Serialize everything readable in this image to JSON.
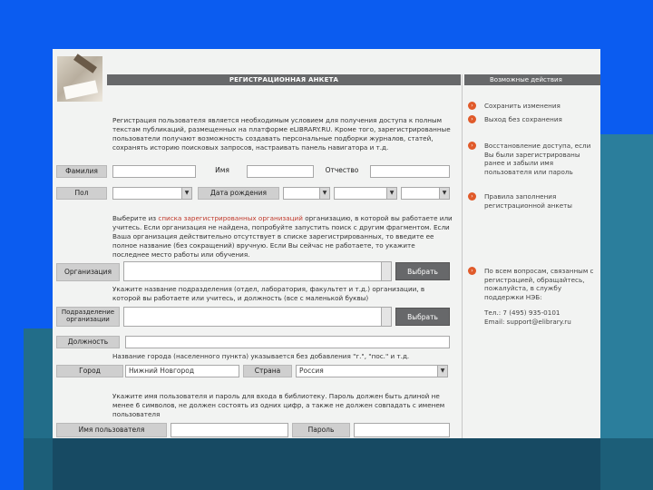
{
  "form": {
    "header": "РЕГИСТРАЦИОННАЯ АНКЕТА",
    "intro": "Регистрация пользователя является необходимым условием для получения доступа к полным текстам публикаций, размещенных на платформе eLIBRARY.RU. Кроме того, зарегистрированные пользователи получают возможность создавать персональные подборки журналов, статей, сохранять историю поисковых запросов, настраивать панель навигатора и т.д.",
    "labels": {
      "lastname": "Фамилия",
      "firstname": "Имя",
      "patronymic": "Отчество",
      "gender": "Пол",
      "birthdate": "Дата рождения",
      "organization": "Организация",
      "department": "Подразделение организации",
      "position": "Должность",
      "city": "Город",
      "country": "Страна",
      "username": "Имя пользователя",
      "password": "Пароль"
    },
    "org_hint_pre": "Выберите из ",
    "org_hint_link": "списка зарегистрированных организаций",
    "org_hint_post": " организацию, в которой вы работаете или учитесь. Если организация не найдена, попробуйте запустить поиск с другим фрагментом. Если Ваша организация действительно отсутствует в списке зарегистрированных, то введите ее полное название (без сокращений) вручную. Если Вы сейчас не работаете, то укажите последнее место работы или обучения.",
    "dept_hint": "Укажите название подразделения (отдел, лаборатория, факультет и т.д.) организации, в которой вы работаете или учитесь, и должность (все с маленькой буквы)",
    "city_hint": "Название города (населенного пункта) указывается без добавления \"г.\", \"пос.\" и т.д.",
    "login_hint": "Укажите имя пользователя и пароль для входа в библиотеку. Пароль должен быть длиной не менее 6 символов, не должен состоять из одних цифр, а также не должен совпадать с именем пользователя",
    "select_button": "Выбрать",
    "city_value": "Нижний Новгород",
    "country_value": "Россия",
    "select_arrow": "▼"
  },
  "sidebar": {
    "header": "Возможные действия",
    "actions": [
      {
        "label": "Сохранить изменения"
      },
      {
        "label": "Выход без сохранения"
      },
      {
        "label": "Восстановление доступа, если Вы были зарегистрированы ранее и забыли имя пользователя или пароль"
      },
      {
        "label": "Правила заполнения регистрационной анкеты"
      }
    ],
    "support_text": "По всем вопросам, связанным с регистрацией, обращайтесь, пожалуйста, в службу поддержки НЭБ:",
    "support_phone": "Тел.: 7 (495) 935-0101",
    "support_email": "Email: support@elibrary.ru",
    "action_icon": "›"
  },
  "colors": {
    "background": "#0b5cf0",
    "header_bar": "#67686a",
    "action_bullet": "#e05a2a",
    "link_red": "#c0392b"
  }
}
